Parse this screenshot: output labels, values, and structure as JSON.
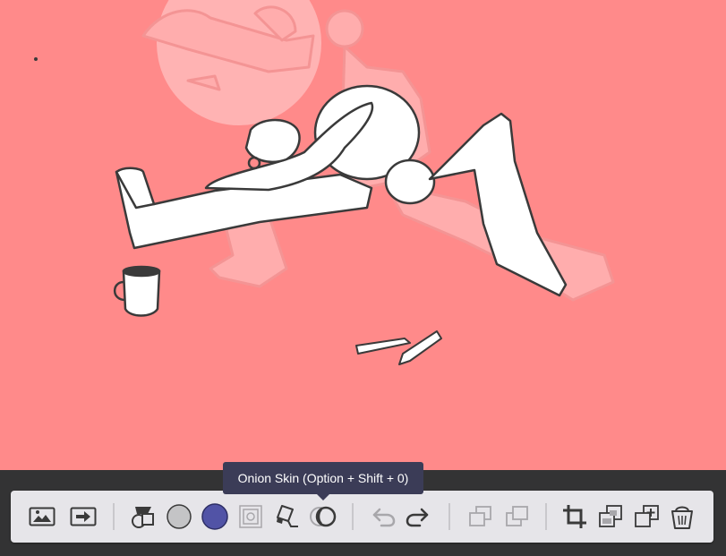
{
  "canvas": {
    "background_color": "#ff8a8a",
    "artwork": "drawing-of-person-stretching-with-onion-skin-ghost-frame"
  },
  "tooltip": {
    "text": "Onion Skin (Option + Shift + 0)"
  },
  "toolbar": {
    "tools": [
      {
        "name": "background-image-icon",
        "state": "enabled"
      },
      {
        "name": "export-arrow-icon",
        "state": "enabled"
      },
      {
        "name": "shapes-icon",
        "state": "enabled"
      },
      {
        "name": "secondary-color-swatch",
        "color": "#c4c4c6"
      },
      {
        "name": "primary-color-swatch",
        "color": "#5153a6"
      },
      {
        "name": "layer-opacity-icon",
        "state": "disabled"
      },
      {
        "name": "eraser-pencil-icon",
        "state": "enabled"
      },
      {
        "name": "onion-skin-icon",
        "state": "hovered"
      },
      {
        "name": "undo-icon",
        "state": "disabled"
      },
      {
        "name": "redo-icon",
        "state": "enabled"
      },
      {
        "name": "layer-back-icon",
        "state": "disabled"
      },
      {
        "name": "layer-forward-icon",
        "state": "disabled"
      },
      {
        "name": "crop-icon",
        "state": "enabled"
      },
      {
        "name": "duplicate-frame-icon",
        "state": "enabled"
      },
      {
        "name": "add-frame-icon",
        "state": "enabled"
      },
      {
        "name": "delete-bucket-icon",
        "state": "enabled"
      }
    ]
  }
}
